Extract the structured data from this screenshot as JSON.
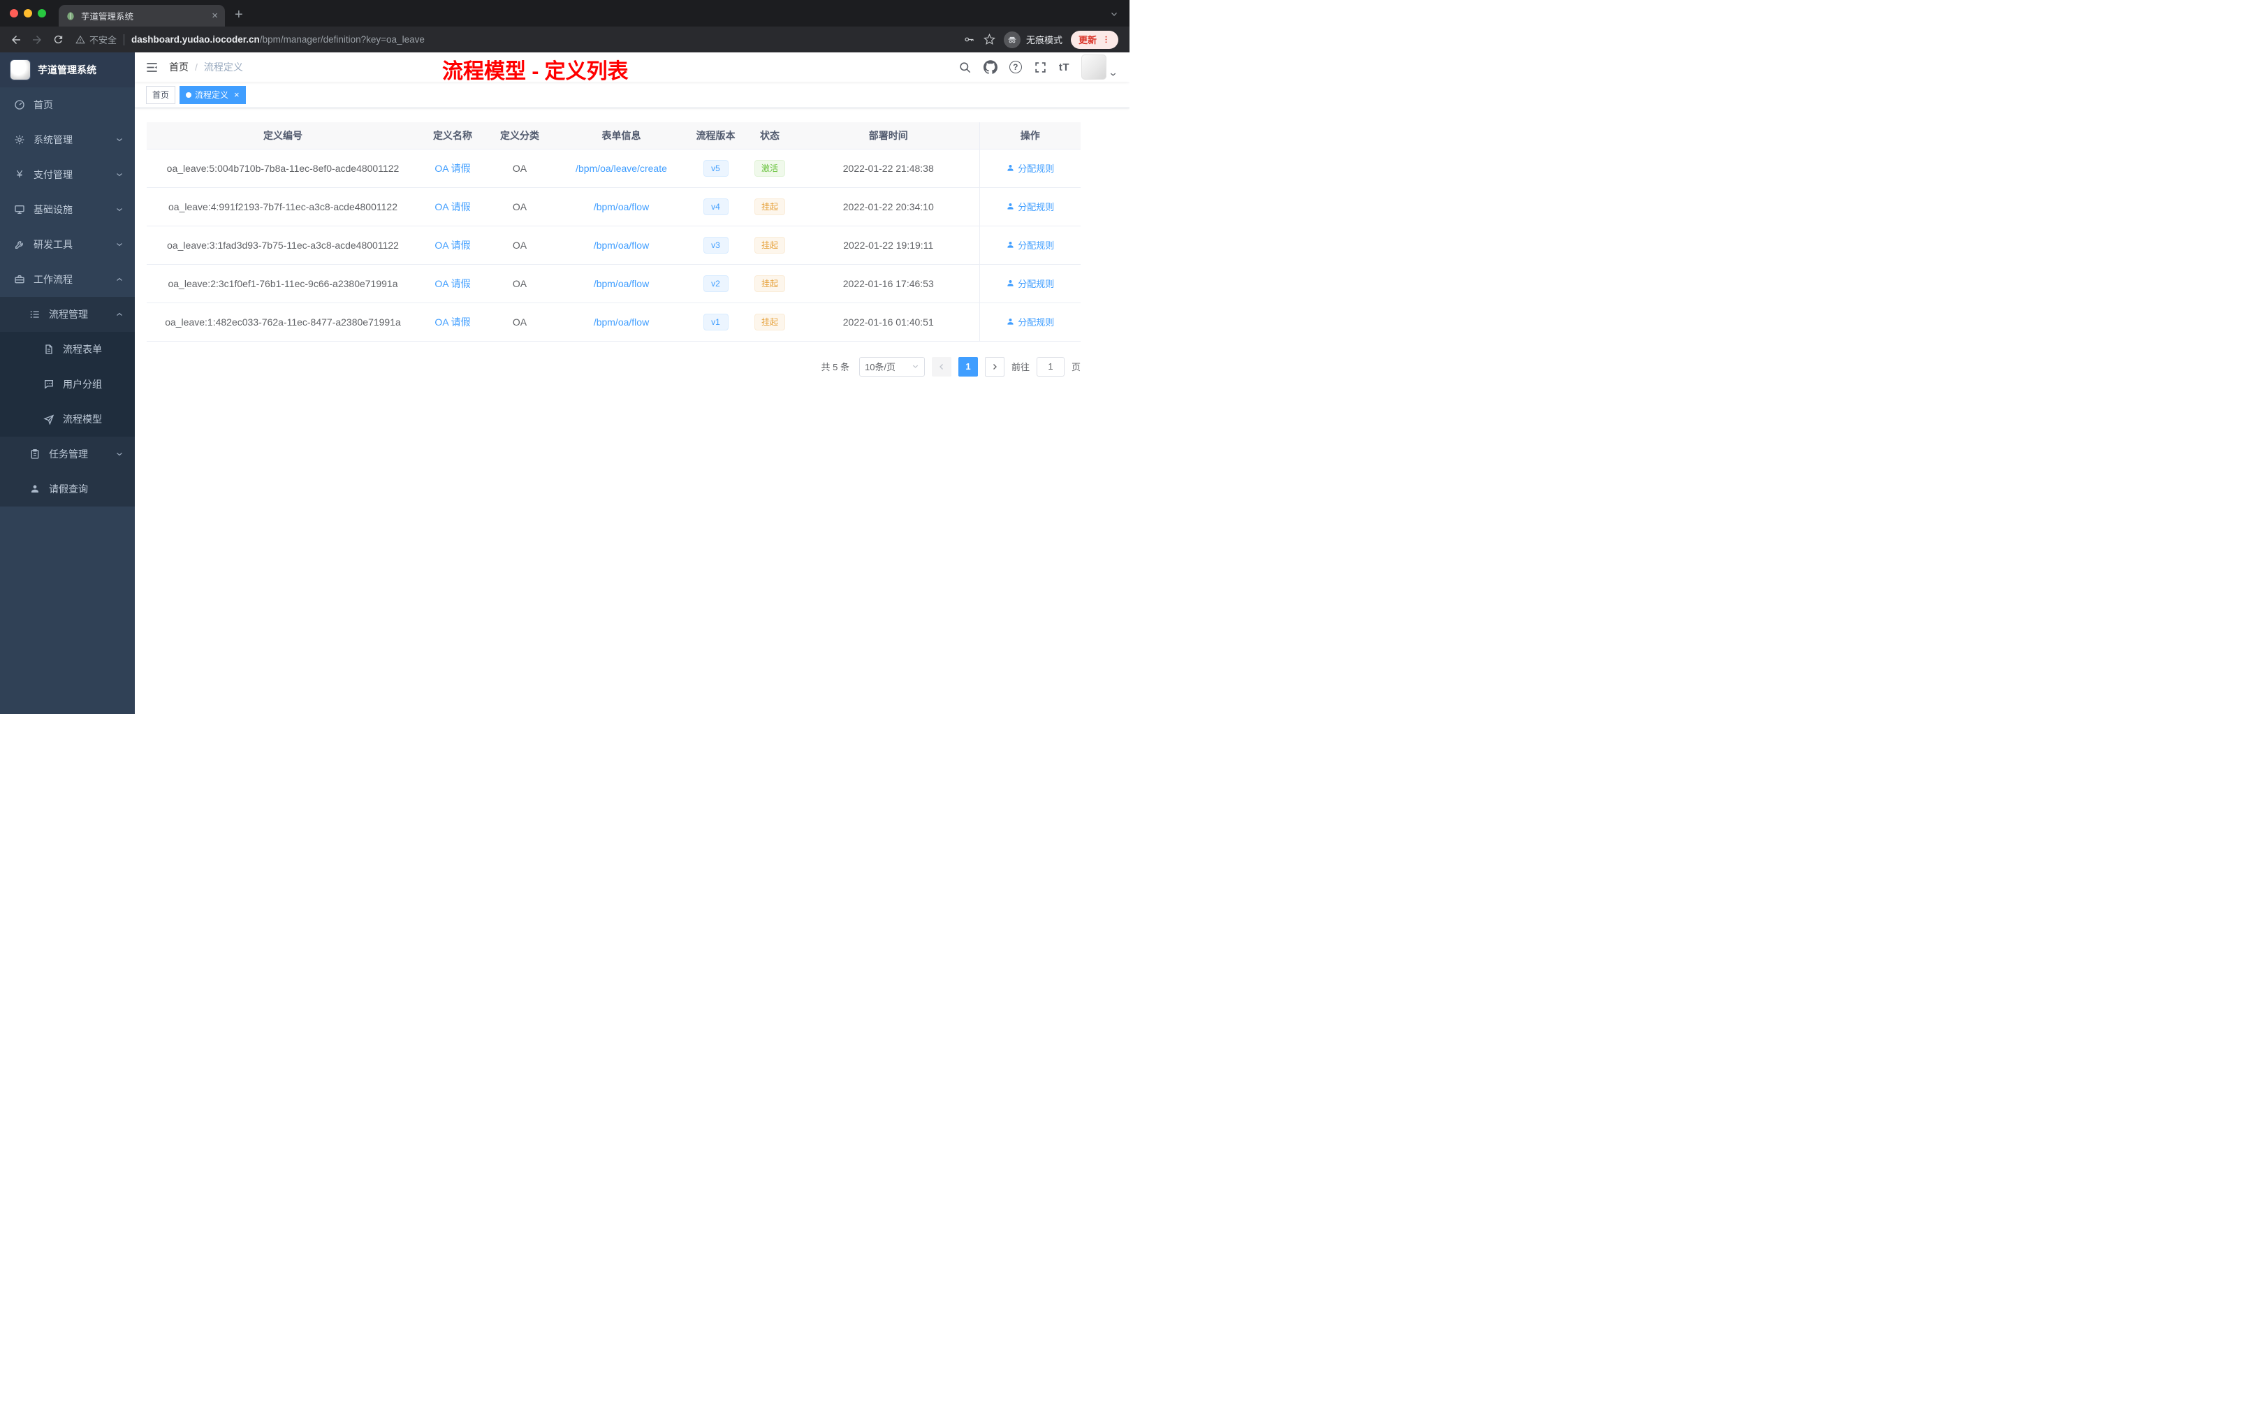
{
  "colors": {
    "accent": "#409eff",
    "annotation": "#ff0000",
    "status_active": "#67c23a",
    "status_suspended": "#e6a23c",
    "sidebar_bg": "#304156",
    "submenu_bg": "#1f2d3d"
  },
  "browser": {
    "tab_title": "芋道管理系统",
    "security_label": "不安全",
    "url_host": "dashboard.yudao.iocoder.cn",
    "url_path": "/bpm/manager/definition?key=oa_leave",
    "incognito_label": "无痕模式",
    "update_label": "更新"
  },
  "sidebar": {
    "logo_title": "芋道管理系统",
    "items": [
      {
        "label": "首页",
        "level": 1,
        "icon": "dashboard-icon",
        "expand": "none"
      },
      {
        "label": "系统管理",
        "level": 1,
        "icon": "gear-icon",
        "expand": "down"
      },
      {
        "label": "支付管理",
        "level": 1,
        "icon": "yen-icon",
        "expand": "down"
      },
      {
        "label": "基础设施",
        "level": 1,
        "icon": "monitor-icon",
        "expand": "down"
      },
      {
        "label": "研发工具",
        "level": 1,
        "icon": "wrench-icon",
        "expand": "down"
      },
      {
        "label": "工作流程",
        "level": 1,
        "icon": "briefcase-icon",
        "expand": "up"
      },
      {
        "label": "流程管理",
        "level": 2,
        "icon": "list-icon",
        "expand": "up"
      },
      {
        "label": "流程表单",
        "level": 3,
        "icon": "document-icon",
        "expand": "none"
      },
      {
        "label": "用户分组",
        "level": 3,
        "icon": "chat-icon",
        "expand": "none"
      },
      {
        "label": "流程模型",
        "level": 3,
        "icon": "paper-plane-icon",
        "expand": "none"
      },
      {
        "label": "任务管理",
        "level": 2,
        "icon": "clipboard-icon",
        "expand": "down"
      },
      {
        "label": "请假查询",
        "level": 2,
        "icon": "user-icon",
        "expand": "none"
      }
    ]
  },
  "header": {
    "breadcrumb_home": "首页",
    "breadcrumb_sep": "/",
    "breadcrumb_current": "流程定义",
    "annotation": "流程模型 - 定义列表",
    "font_size_tool": "tT"
  },
  "tags": {
    "home_label": "首页",
    "active_label": "流程定义"
  },
  "table": {
    "columns": [
      "定义编号",
      "定义名称",
      "定义分类",
      "表单信息",
      "流程版本",
      "状态",
      "部署时间",
      "操作"
    ],
    "rows": [
      {
        "id": "oa_leave:5:004b710b-7b8a-11ec-8ef0-acde48001122",
        "name": "OA 请假",
        "category": "OA",
        "form": "/bpm/oa/leave/create",
        "version": "v5",
        "status": "激活",
        "status_type": "success",
        "time": "2022-01-22 21:48:38",
        "action": "分配规则"
      },
      {
        "id": "oa_leave:4:991f2193-7b7f-11ec-a3c8-acde48001122",
        "name": "OA 请假",
        "category": "OA",
        "form": "/bpm/oa/flow",
        "version": "v4",
        "status": "挂起",
        "status_type": "warning",
        "time": "2022-01-22 20:34:10",
        "action": "分配规则"
      },
      {
        "id": "oa_leave:3:1fad3d93-7b75-11ec-a3c8-acde48001122",
        "name": "OA 请假",
        "category": "OA",
        "form": "/bpm/oa/flow",
        "version": "v3",
        "status": "挂起",
        "status_type": "warning",
        "time": "2022-01-22 19:19:11",
        "action": "分配规则"
      },
      {
        "id": "oa_leave:2:3c1f0ef1-76b1-11ec-9c66-a2380e71991a",
        "name": "OA 请假",
        "category": "OA",
        "form": "/bpm/oa/flow",
        "version": "v2",
        "status": "挂起",
        "status_type": "warning",
        "time": "2022-01-16 17:46:53",
        "action": "分配规则"
      },
      {
        "id": "oa_leave:1:482ec033-762a-11ec-8477-a2380e71991a",
        "name": "OA 请假",
        "category": "OA",
        "form": "/bpm/oa/flow",
        "version": "v1",
        "status": "挂起",
        "status_type": "warning",
        "time": "2022-01-16 01:40:51",
        "action": "分配规则"
      }
    ]
  },
  "pagination": {
    "total_label": "共 5 条",
    "page_size_label": "10条/页",
    "current_page": "1",
    "goto_label": "前往",
    "goto_value": "1",
    "unit_label": "页"
  }
}
